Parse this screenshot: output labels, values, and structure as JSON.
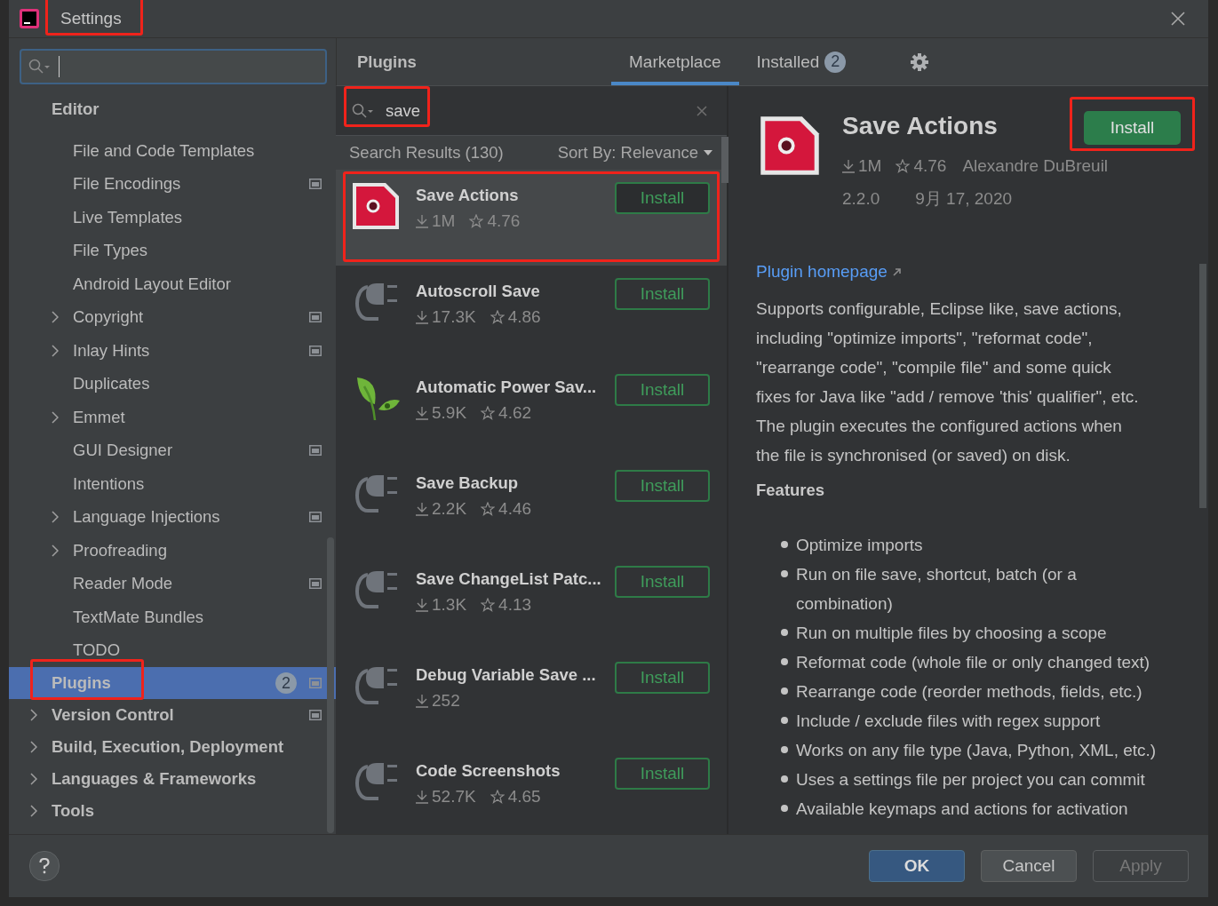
{
  "window": {
    "title": "Settings",
    "highlighted": true
  },
  "sidebar": {
    "items": [
      {
        "label": "Editor",
        "expandable": false,
        "project_scope": false,
        "selected": false,
        "children": [
          {
            "label": "File and Code Templates",
            "expandable": false,
            "project_scope": false,
            "selected": false,
            "highlighted": false
          },
          {
            "label": "File Encodings",
            "expandable": false,
            "project_scope": true,
            "selected": false,
            "highlighted": false
          },
          {
            "label": "Live Templates",
            "expandable": false,
            "project_scope": false,
            "selected": false,
            "highlighted": false
          },
          {
            "label": "File Types",
            "expandable": false,
            "project_scope": false,
            "selected": false,
            "highlighted": false
          },
          {
            "label": "Android Layout Editor",
            "expandable": false,
            "project_scope": false,
            "selected": false,
            "highlighted": false
          },
          {
            "label": "Copyright",
            "expandable": true,
            "project_scope": true,
            "selected": false,
            "highlighted": false
          },
          {
            "label": "Inlay Hints",
            "expandable": true,
            "project_scope": true,
            "selected": false,
            "highlighted": false
          },
          {
            "label": "Duplicates",
            "expandable": false,
            "project_scope": false,
            "selected": false,
            "highlighted": false
          },
          {
            "label": "Emmet",
            "expandable": true,
            "project_scope": false,
            "selected": false,
            "highlighted": false
          },
          {
            "label": "GUI Designer",
            "expandable": false,
            "project_scope": true,
            "selected": false,
            "highlighted": false
          },
          {
            "label": "Intentions",
            "expandable": false,
            "project_scope": false,
            "selected": false,
            "highlighted": false
          },
          {
            "label": "Language Injections",
            "expandable": true,
            "project_scope": true,
            "selected": false,
            "highlighted": false
          },
          {
            "label": "Proofreading",
            "expandable": true,
            "project_scope": false,
            "selected": false,
            "highlighted": false
          },
          {
            "label": "Reader Mode",
            "expandable": false,
            "project_scope": true,
            "selected": false,
            "highlighted": false
          },
          {
            "label": "TextMate Bundles",
            "expandable": false,
            "project_scope": false,
            "selected": false,
            "highlighted": false
          },
          {
            "label": "TODO",
            "expandable": false,
            "project_scope": false,
            "selected": false,
            "highlighted": false
          }
        ]
      },
      {
        "label": "Plugins",
        "expandable": false,
        "project_scope": true,
        "selected": true,
        "highlighted": true,
        "badge": "2"
      },
      {
        "label": "Version Control",
        "expandable": true,
        "project_scope": true,
        "selected": false,
        "highlighted": false
      },
      {
        "label": "Build, Execution, Deployment",
        "expandable": true,
        "project_scope": false,
        "selected": false,
        "highlighted": false
      },
      {
        "label": "Languages & Frameworks",
        "expandable": true,
        "project_scope": false,
        "selected": false,
        "highlighted": false
      },
      {
        "label": "Tools",
        "expandable": true,
        "project_scope": false,
        "selected": false,
        "highlighted": false
      }
    ]
  },
  "plugins": {
    "title": "Plugins",
    "tabs": [
      {
        "label": "Marketplace",
        "selected": true
      },
      {
        "label": "Installed",
        "selected": false,
        "badge": "2"
      }
    ],
    "search": {
      "value": "save",
      "highlighted": true
    },
    "results_label": "Search Results (130)",
    "sort_label": "Sort By: Relevance",
    "results": [
      {
        "name": "Save Actions",
        "kind": "red-page",
        "downloads": "1M",
        "rating": "4.76",
        "button": "Install",
        "selected": true,
        "highlighted": true
      },
      {
        "name": "Autoscroll Save",
        "kind": "plug",
        "downloads": "17.3K",
        "rating": "4.86",
        "button": "Install",
        "selected": false,
        "highlighted": false
      },
      {
        "name": "Automatic Power Sav...",
        "kind": "leaf",
        "downloads": "5.9K",
        "rating": "4.62",
        "button": "Install",
        "selected": false,
        "highlighted": false
      },
      {
        "name": "Save Backup",
        "kind": "plug",
        "downloads": "2.2K",
        "rating": "4.46",
        "button": "Install",
        "selected": false,
        "highlighted": false
      },
      {
        "name": "Save ChangeList Patc...",
        "kind": "plug",
        "downloads": "1.3K",
        "rating": "4.13",
        "button": "Install",
        "selected": false,
        "highlighted": false
      },
      {
        "name": "Debug Variable Save ...",
        "kind": "plug",
        "downloads": "252",
        "button": "Install",
        "selected": false,
        "highlighted": false
      },
      {
        "name": "Code Screenshots",
        "kind": "plug",
        "downloads": "52.7K",
        "rating": "4.65",
        "button": "Install",
        "selected": false,
        "highlighted": false
      }
    ]
  },
  "details": {
    "name": "Save Actions",
    "kind": "red-page",
    "downloads": "1M",
    "rating": "4.76",
    "vendor": "Alexandre DuBreuil",
    "version": "2.2.0",
    "date": "9月 17, 2020",
    "install": {
      "label": "Install",
      "highlighted": true
    },
    "homepage": "Plugin homepage",
    "description": "Supports configurable, Eclipse like, save actions, including \"optimize imports\", \"reformat code\", \"rearrange code\", \"compile file\" and some quick fixes for Java like \"add / remove 'this' qualifier\", etc. The plugin executes the configured actions when the file is synchronised (or saved) on disk.",
    "features_heading": "Features",
    "features": [
      "Optimize imports",
      "Run on file save, shortcut, batch (or a combination)",
      "Run on multiple files by choosing a scope",
      "Reformat code (whole file or only changed text)",
      "Rearrange code (reorder methods, fields, etc.)",
      "Include / exclude files with regex support",
      "Works on any file type (Java, Python, XML, etc.)",
      "Uses a settings file per project you can commit",
      "Available keymaps and actions for activation"
    ]
  },
  "footer": {
    "buttons": [
      {
        "label": "OK",
        "primary": true,
        "disabled": false
      },
      {
        "label": "Cancel",
        "primary": false,
        "disabled": false
      },
      {
        "label": "Apply",
        "primary": false,
        "disabled": true
      }
    ]
  }
}
